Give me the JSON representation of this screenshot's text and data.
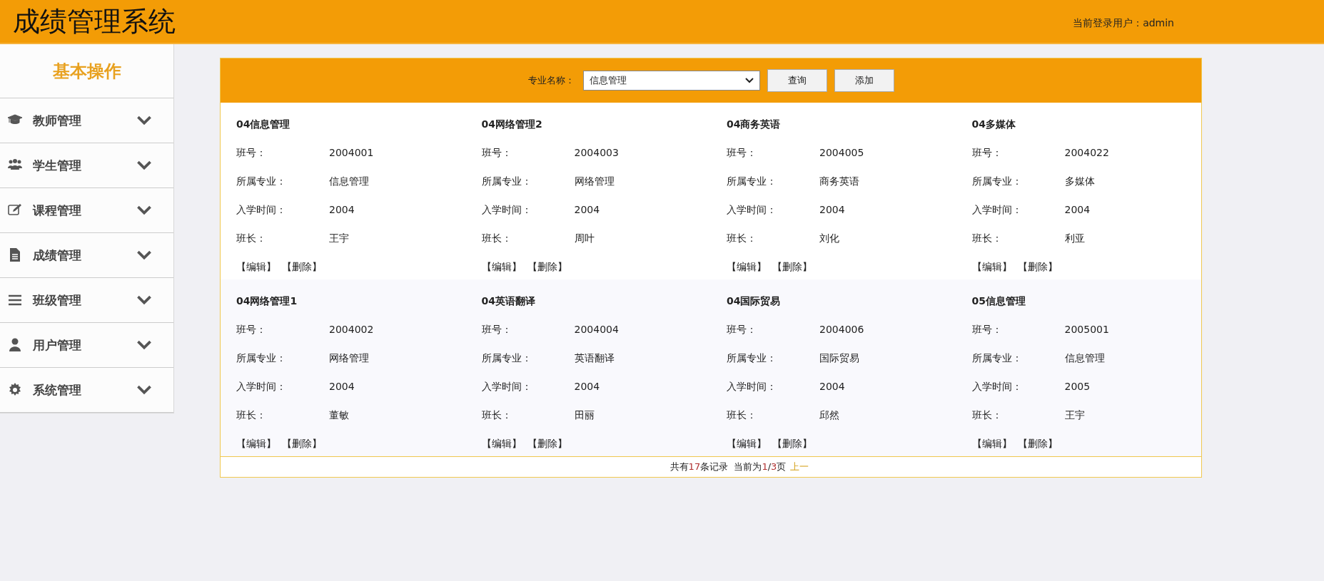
{
  "header": {
    "title": "成绩管理系统",
    "user_label": "当前登录用户：",
    "user": "admin"
  },
  "sidebar": {
    "title": "基本操作",
    "items": [
      {
        "label": "教师管理",
        "expanded": false
      },
      {
        "label": "学生管理",
        "expanded": false
      },
      {
        "label": "课程管理",
        "expanded": false
      },
      {
        "label": "成绩管理",
        "expanded": false
      },
      {
        "label": "班级管理",
        "expanded": false
      },
      {
        "label": "用户管理",
        "expanded": false
      },
      {
        "label": "系统管理",
        "expanded": false
      }
    ]
  },
  "toolbar": {
    "major_label": "专业名称：",
    "major_value": "信息管理",
    "buttons": [
      "查询",
      "添加"
    ]
  },
  "cards": [
    {
      "title": "04信息管理",
      "fields": [
        {
          "label": "班号：",
          "value": "2004001"
        },
        {
          "label": "所属专业：",
          "value": "信息管理"
        },
        {
          "label": "入学时间：",
          "value": "2004"
        },
        {
          "label": "班长：",
          "value": "王宇"
        }
      ],
      "actions": [
        "【编辑】",
        "【删除】"
      ]
    },
    {
      "title": "04网络管理2",
      "fields": [
        {
          "label": "班号：",
          "value": "2004003"
        },
        {
          "label": "所属专业：",
          "value": "网络管理"
        },
        {
          "label": "入学时间：",
          "value": "2004"
        },
        {
          "label": "班长：",
          "value": "周叶"
        }
      ],
      "actions": [
        "【编辑】",
        "【删除】"
      ]
    },
    {
      "title": "04商务英语",
      "fields": [
        {
          "label": "班号：",
          "value": "2004005"
        },
        {
          "label": "所属专业：",
          "value": "商务英语"
        },
        {
          "label": "入学时间：",
          "value": "2004"
        },
        {
          "label": "班长：",
          "value": "刘化"
        }
      ],
      "actions": [
        "【编辑】",
        "【删除】"
      ]
    },
    {
      "title": "04多媒体",
      "fields": [
        {
          "label": "班号：",
          "value": "2004022"
        },
        {
          "label": "所属专业：",
          "value": "多媒体"
        },
        {
          "label": "入学时间：",
          "value": "2004"
        },
        {
          "label": "班长：",
          "value": "利亚"
        }
      ],
      "actions": [
        "【编辑】",
        "【删除】"
      ]
    },
    {
      "title": "04网络管理1",
      "fields": [
        {
          "label": "班号：",
          "value": "2004002"
        },
        {
          "label": "所属专业：",
          "value": "网络管理"
        },
        {
          "label": "入学时间：",
          "value": "2004"
        },
        {
          "label": "班长：",
          "value": "董敏"
        }
      ],
      "actions": [
        "【编辑】",
        "【删除】"
      ]
    },
    {
      "title": "04英语翻译",
      "fields": [
        {
          "label": "班号：",
          "value": "2004004"
        },
        {
          "label": "所属专业：",
          "value": "英语翻译"
        },
        {
          "label": "入学时间：",
          "value": "2004"
        },
        {
          "label": "班长：",
          "value": "田丽"
        }
      ],
      "actions": [
        "【编辑】",
        "【删除】"
      ]
    },
    {
      "title": "04国际贸易",
      "fields": [
        {
          "label": "班号：",
          "value": "2004006"
        },
        {
          "label": "所属专业：",
          "value": "国际贸易"
        },
        {
          "label": "入学时间：",
          "value": "2004"
        },
        {
          "label": "班长：",
          "value": "邱然"
        }
      ],
      "actions": [
        "【编辑】",
        "【删除】"
      ]
    },
    {
      "title": "05信息管理",
      "fields": [
        {
          "label": "班号：",
          "value": "2005001"
        },
        {
          "label": "所属专业：",
          "value": "信息管理"
        },
        {
          "label": "入学时间：",
          "value": "2005"
        },
        {
          "label": "班长：",
          "value": "王宇"
        }
      ],
      "actions": [
        "【编辑】",
        "【删除】"
      ]
    }
  ],
  "pagination": {
    "summary": [
      {
        "kind": "plain",
        "text": "共有"
      },
      {
        "kind": "number",
        "text": "17"
      },
      {
        "kind": "plain",
        "text": "条记录  当前为"
      },
      {
        "kind": "number",
        "text": "1"
      },
      {
        "kind": "plain",
        "text": "/"
      },
      {
        "kind": "number",
        "text": "3"
      },
      {
        "kind": "plain",
        "text": "页"
      }
    ],
    "link": "上一"
  }
}
